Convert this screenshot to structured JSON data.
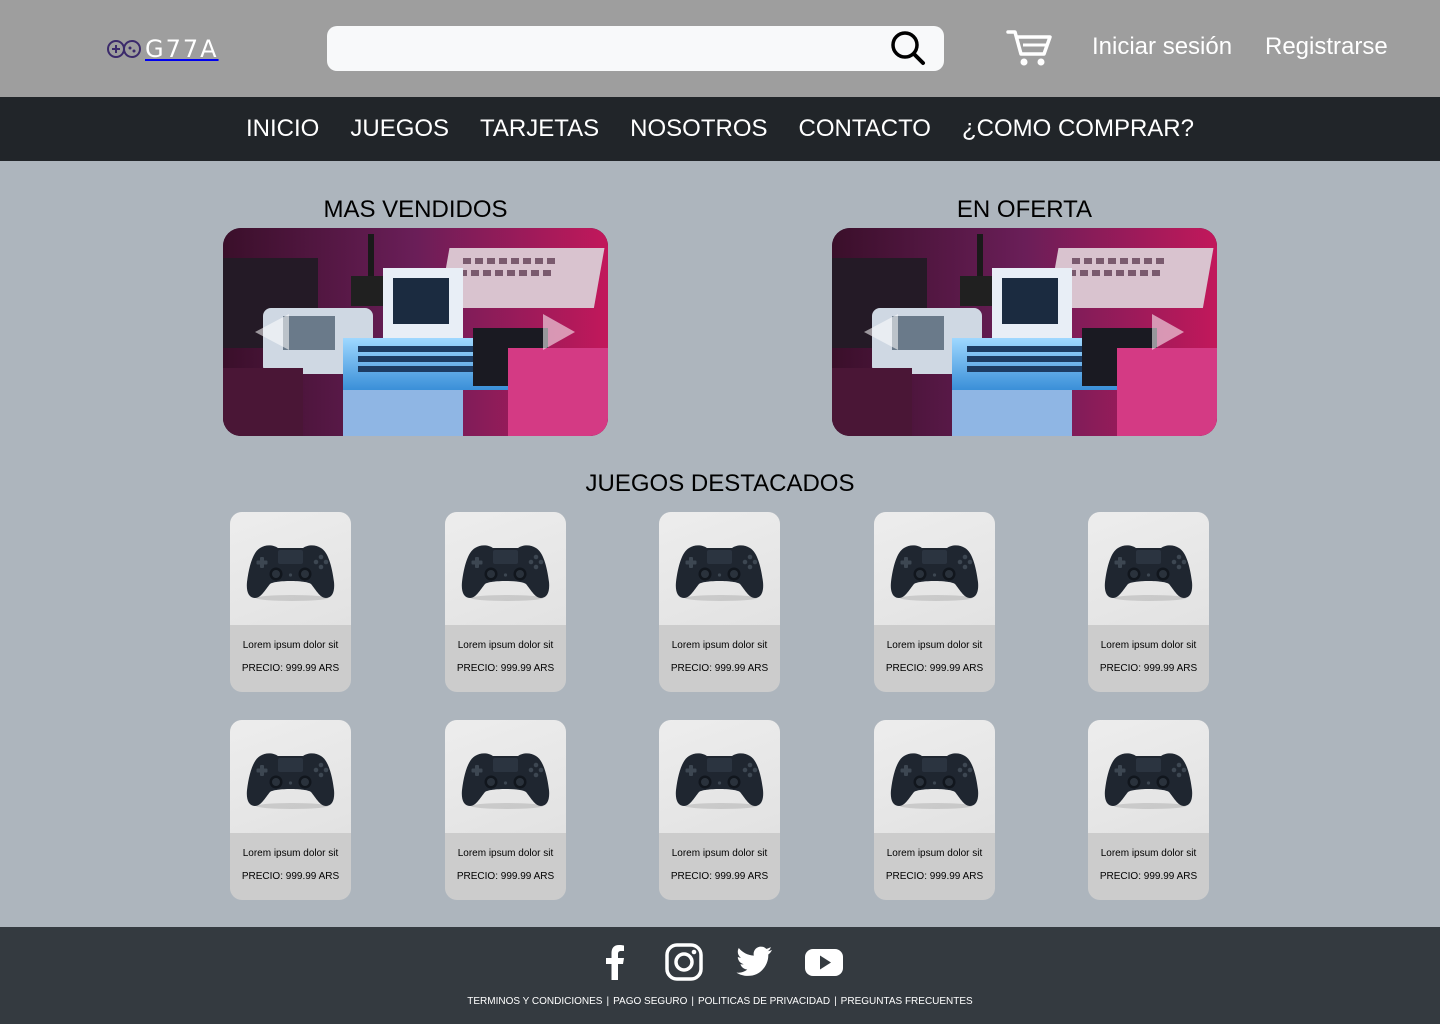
{
  "header": {
    "logo_text": "G77A",
    "logo_icon": "gamepad-icon",
    "search_placeholder": "",
    "search_icon": "search-icon",
    "cart_icon": "cart-icon",
    "login_label": "Iniciar sesión",
    "register_label": "Registrarse"
  },
  "nav": {
    "items": [
      {
        "label": "INICIO"
      },
      {
        "label": "JUEGOS"
      },
      {
        "label": "TARJETAS"
      },
      {
        "label": "NOSOTROS"
      },
      {
        "label": "CONTACTO"
      },
      {
        "label": "¿COMO COMPRAR?"
      }
    ]
  },
  "carousels": [
    {
      "title": "MAS VENDIDOS",
      "prev_icon": "arrow-left-icon",
      "next_icon": "arrow-right-icon"
    },
    {
      "title": "EN OFERTA",
      "prev_icon": "arrow-left-icon",
      "next_icon": "arrow-right-icon"
    }
  ],
  "featured": {
    "title": "JUEGOS DESTACADOS",
    "products": [
      {
        "name": "Lorem ipsum dolor sit",
        "price": "PRECIO: 999.99 ARS"
      },
      {
        "name": "Lorem ipsum dolor sit",
        "price": "PRECIO: 999.99 ARS"
      },
      {
        "name": "Lorem ipsum dolor sit",
        "price": "PRECIO: 999.99 ARS"
      },
      {
        "name": "Lorem ipsum dolor sit",
        "price": "PRECIO: 999.99 ARS"
      },
      {
        "name": "Lorem ipsum dolor sit",
        "price": "PRECIO: 999.99 ARS"
      },
      {
        "name": "Lorem ipsum dolor sit",
        "price": "PRECIO: 999.99 ARS"
      },
      {
        "name": "Lorem ipsum dolor sit",
        "price": "PRECIO: 999.99 ARS"
      },
      {
        "name": "Lorem ipsum dolor sit",
        "price": "PRECIO: 999.99 ARS"
      },
      {
        "name": "Lorem ipsum dolor sit",
        "price": "PRECIO: 999.99 ARS"
      },
      {
        "name": "Lorem ipsum dolor sit",
        "price": "PRECIO: 999.99 ARS"
      }
    ]
  },
  "footer": {
    "social_icons": [
      "facebook-icon",
      "instagram-icon",
      "twitter-icon",
      "youtube-icon"
    ],
    "links": [
      {
        "label": "TERMINOS Y CONDICIONES"
      },
      {
        "label": "PAGO SEGURO"
      },
      {
        "label": "POLITICAS DE PRIVACIDAD"
      },
      {
        "label": "PREGUNTAS FRECUENTES"
      }
    ],
    "separator": "|"
  },
  "colors": {
    "header_bg": "#9e9e9e",
    "nav_bg": "#212529",
    "page_bg": "#adb5bd",
    "footer_bg": "#343a40",
    "logo_accent": "#3b2a6b"
  }
}
